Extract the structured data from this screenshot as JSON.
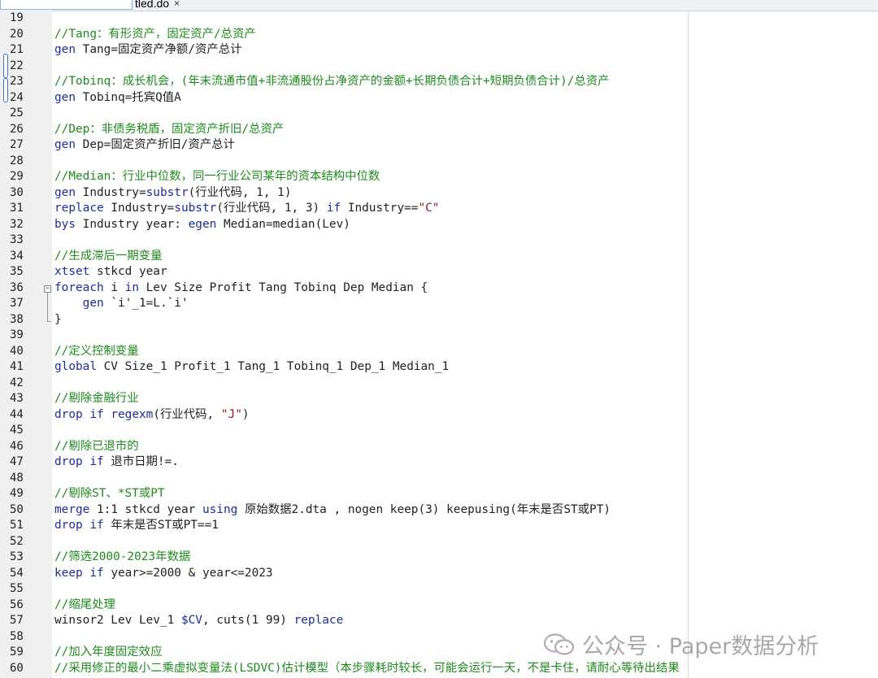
{
  "tab": {
    "title": "tled.do",
    "close": "×"
  },
  "lines": [
    {
      "n": "19",
      "segs": []
    },
    {
      "n": "20",
      "segs": [
        {
          "t": "//Tang：有形资产，固定资产/总资产",
          "c": "c"
        }
      ]
    },
    {
      "n": "21",
      "segs": [
        {
          "t": "gen",
          "c": "k"
        },
        {
          "t": " Tang=固定资产净额/资产总计",
          "c": "m"
        }
      ]
    },
    {
      "n": "22",
      "segs": []
    },
    {
      "n": "23",
      "segs": [
        {
          "t": "//Tobinq：成长机会，(年末流通市值+非流通股份占净资产的金额+长期负债合计+短期负债合计)/总资产",
          "c": "c"
        }
      ]
    },
    {
      "n": "24",
      "segs": [
        {
          "t": "gen",
          "c": "k"
        },
        {
          "t": " Tobinq=托宾Q值A",
          "c": "m"
        }
      ]
    },
    {
      "n": "25",
      "segs": []
    },
    {
      "n": "26",
      "segs": [
        {
          "t": "//Dep：非债务税盾，固定资产折旧/总资产",
          "c": "c"
        }
      ]
    },
    {
      "n": "27",
      "segs": [
        {
          "t": "gen",
          "c": "k"
        },
        {
          "t": " Dep=固定资产折旧/资产总计",
          "c": "m"
        }
      ]
    },
    {
      "n": "28",
      "segs": []
    },
    {
      "n": "29",
      "segs": [
        {
          "t": "//Median：行业中位数，同一行业公司某年的资本结构中位数",
          "c": "c"
        }
      ]
    },
    {
      "n": "30",
      "segs": [
        {
          "t": "gen",
          "c": "k"
        },
        {
          "t": " Industry=",
          "c": "m"
        },
        {
          "t": "substr",
          "c": "k"
        },
        {
          "t": "(行业代码, 1, 1)",
          "c": "m"
        }
      ]
    },
    {
      "n": "31",
      "segs": [
        {
          "t": "replace",
          "c": "k"
        },
        {
          "t": " Industry=",
          "c": "m"
        },
        {
          "t": "substr",
          "c": "k"
        },
        {
          "t": "(行业代码, 1, 3) ",
          "c": "m"
        },
        {
          "t": "if",
          "c": "k"
        },
        {
          "t": " Industry==",
          "c": "m"
        },
        {
          "t": "\"C\"",
          "c": "s"
        }
      ]
    },
    {
      "n": "32",
      "segs": [
        {
          "t": "bys",
          "c": "k"
        },
        {
          "t": " Industry year: ",
          "c": "m"
        },
        {
          "t": "egen",
          "c": "k"
        },
        {
          "t": " Median=median(Lev)",
          "c": "m"
        }
      ]
    },
    {
      "n": "33",
      "segs": []
    },
    {
      "n": "34",
      "segs": [
        {
          "t": "//生成滞后一期变量",
          "c": "c"
        }
      ]
    },
    {
      "n": "35",
      "segs": [
        {
          "t": "xtset",
          "c": "k"
        },
        {
          "t": " stkcd year",
          "c": "m"
        }
      ]
    },
    {
      "n": "36",
      "segs": [
        {
          "t": "foreach",
          "c": "k"
        },
        {
          "t": " i ",
          "c": "m"
        },
        {
          "t": "in",
          "c": "k"
        },
        {
          "t": " Lev Size Profit Tang Tobinq Dep Median {",
          "c": "m"
        }
      ]
    },
    {
      "n": "37",
      "segs": [
        {
          "t": "    ",
          "c": "m"
        },
        {
          "t": "gen",
          "c": "k"
        },
        {
          "t": " `i'_1=L.`i'",
          "c": "m"
        }
      ]
    },
    {
      "n": "38",
      "segs": [
        {
          "t": "}",
          "c": "m"
        }
      ]
    },
    {
      "n": "39",
      "segs": []
    },
    {
      "n": "40",
      "segs": [
        {
          "t": "//定义控制变量",
          "c": "c"
        }
      ]
    },
    {
      "n": "41",
      "segs": [
        {
          "t": "global",
          "c": "k"
        },
        {
          "t": " CV Size_1 Profit_1 Tang_1 Tobinq_1 Dep_1 Median_1",
          "c": "m"
        }
      ]
    },
    {
      "n": "42",
      "segs": []
    },
    {
      "n": "43",
      "segs": [
        {
          "t": "//剔除金融行业",
          "c": "c"
        }
      ]
    },
    {
      "n": "44",
      "segs": [
        {
          "t": "drop",
          "c": "k"
        },
        {
          "t": " ",
          "c": "m"
        },
        {
          "t": "if",
          "c": "k"
        },
        {
          "t": " ",
          "c": "m"
        },
        {
          "t": "regexm",
          "c": "k"
        },
        {
          "t": "(行业代码, ",
          "c": "m"
        },
        {
          "t": "\"J\"",
          "c": "s"
        },
        {
          "t": ")",
          "c": "m"
        }
      ]
    },
    {
      "n": "45",
      "segs": []
    },
    {
      "n": "46",
      "segs": [
        {
          "t": "//剔除已退市的",
          "c": "c"
        }
      ]
    },
    {
      "n": "47",
      "segs": [
        {
          "t": "drop",
          "c": "k"
        },
        {
          "t": " ",
          "c": "m"
        },
        {
          "t": "if",
          "c": "k"
        },
        {
          "t": " 退市日期!=.",
          "c": "m"
        }
      ]
    },
    {
      "n": "48",
      "segs": []
    },
    {
      "n": "49",
      "segs": [
        {
          "t": "//剔除ST、*ST或PT",
          "c": "c"
        }
      ]
    },
    {
      "n": "50",
      "segs": [
        {
          "t": "merge",
          "c": "k"
        },
        {
          "t": " 1:1 stkcd year ",
          "c": "m"
        },
        {
          "t": "using",
          "c": "k"
        },
        {
          "t": " 原始数据2.dta , nogen keep(3) keepusing(年末是否ST或PT)",
          "c": "m"
        }
      ]
    },
    {
      "n": "51",
      "segs": [
        {
          "t": "drop",
          "c": "k"
        },
        {
          "t": " ",
          "c": "m"
        },
        {
          "t": "if",
          "c": "k"
        },
        {
          "t": " 年末是否ST或PT==1",
          "c": "m"
        }
      ]
    },
    {
      "n": "52",
      "segs": []
    },
    {
      "n": "53",
      "segs": [
        {
          "t": "//筛选2000-2023年数据",
          "c": "c"
        }
      ]
    },
    {
      "n": "54",
      "segs": [
        {
          "t": "keep",
          "c": "k"
        },
        {
          "t": " ",
          "c": "m"
        },
        {
          "t": "if",
          "c": "k"
        },
        {
          "t": " year>=2000 & year<=2023",
          "c": "m"
        }
      ]
    },
    {
      "n": "55",
      "segs": []
    },
    {
      "n": "56",
      "segs": [
        {
          "t": "//缩尾处理",
          "c": "c"
        }
      ]
    },
    {
      "n": "57",
      "segs": [
        {
          "t": "winsor2 Lev Lev_1 ",
          "c": "m"
        },
        {
          "t": "$CV",
          "c": "k"
        },
        {
          "t": ", cuts(1 99) ",
          "c": "m"
        },
        {
          "t": "replace",
          "c": "k"
        }
      ]
    },
    {
      "n": "58",
      "segs": []
    },
    {
      "n": "59",
      "segs": [
        {
          "t": "//加入年度固定效应",
          "c": "c"
        }
      ]
    },
    {
      "n": "60",
      "segs": [
        {
          "t": "//采用修正的最小二乘虚拟变量法(LSDVC)估计模型（本步骤耗时较长，可能会运行一天，不是卡住，请耐心等待出结果",
          "c": "c"
        }
      ]
    }
  ],
  "watermark": {
    "text": "公众号 · Paper数据分析"
  }
}
